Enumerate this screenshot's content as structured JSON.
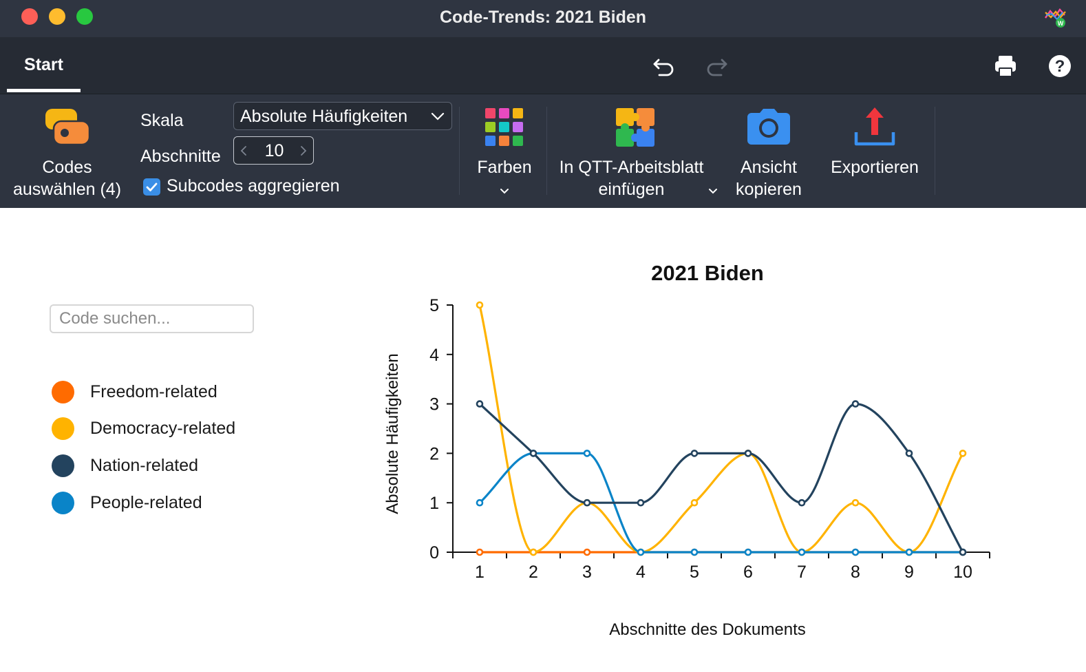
{
  "window": {
    "title": "Code-Trends: 2021 Biden"
  },
  "tabs": [
    {
      "label": "Start"
    }
  ],
  "ribbon": {
    "codes_label_line1": "Codes",
    "codes_label_line2": "auswählen (4)",
    "skala_label": "Skala",
    "skala_value": "Absolute Häufigkeiten",
    "abschnitte_label": "Abschnitte",
    "abschnitte_value": "10",
    "subcodes_label": "Subcodes aggregieren",
    "subcodes_checked": true,
    "farben_label": "Farben",
    "qtt_line1": "In QTT-Arbeitsblatt",
    "qtt_line2": "einfügen",
    "ansicht_line1": "Ansicht",
    "ansicht_line2": "kopieren",
    "export_label": "Exportieren"
  },
  "toolbar_icons": [
    "undo-icon",
    "redo-icon",
    "print-icon",
    "help-icon"
  ],
  "sidebar": {
    "search_placeholder": "Code suchen...",
    "legend": [
      {
        "label": "Freedom-related",
        "color": "#ff6b00"
      },
      {
        "label": "Democracy-related",
        "color": "#ffb300"
      },
      {
        "label": "Nation-related",
        "color": "#23435e"
      },
      {
        "label": "People-related",
        "color": "#0a84c8"
      }
    ]
  },
  "chart_data": {
    "type": "line",
    "title": "2021 Biden",
    "xlabel": "Abschnitte des Dokuments",
    "ylabel": "Absolute Häufigkeiten",
    "x": [
      1,
      2,
      3,
      4,
      5,
      6,
      7,
      8,
      9,
      10
    ],
    "ylim": [
      0,
      5
    ],
    "yticks": [
      0,
      1,
      2,
      3,
      4,
      5
    ],
    "grid": false,
    "legend": "left sidebar",
    "series": [
      {
        "name": "Freedom-related",
        "color": "#ff6b00",
        "values": [
          0,
          0,
          0,
          0,
          0,
          0,
          0,
          0,
          0,
          0
        ]
      },
      {
        "name": "Democracy-related",
        "color": "#ffb300",
        "values": [
          5,
          0,
          1,
          0,
          1,
          2,
          0,
          1,
          0,
          2
        ]
      },
      {
        "name": "People-related",
        "color": "#0a84c8",
        "values": [
          1,
          2,
          2,
          0,
          0,
          0,
          0,
          0,
          0,
          0
        ]
      },
      {
        "name": "Nation-related",
        "color": "#23435e",
        "values": [
          3,
          2,
          1,
          1,
          2,
          2,
          1,
          3,
          2,
          0
        ]
      }
    ]
  }
}
